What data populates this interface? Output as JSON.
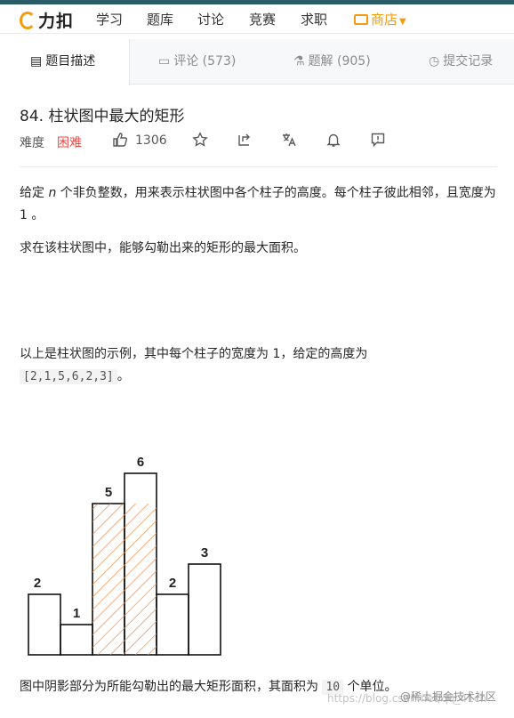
{
  "nav": {
    "logo": "力扣",
    "items": [
      "学习",
      "题库",
      "讨论",
      "竞赛",
      "求职"
    ],
    "shop": "商店"
  },
  "tabs": [
    {
      "label": "题目描述"
    },
    {
      "label": "评论 (573)"
    },
    {
      "label": "题解 (905)"
    },
    {
      "label": "提交记录"
    }
  ],
  "problem": {
    "title": "84. 柱状图中最大的矩形",
    "difficulty_label": "难度",
    "difficulty": "困难",
    "likes": "1306"
  },
  "description": {
    "p1_pre": "给定 ",
    "p1_var": "n",
    "p1_post": " 个非负整数，用来表示柱状图中各个柱子的高度。每个柱子彼此相邻，且宽度为 1 。",
    "p2": "求在该柱状图中，能够勾勒出来的矩形的最大面积。",
    "p3_pre": "以上是柱状图的示例，其中每个柱子的宽度为 1，给定的高度为 ",
    "p3_code": "[2,1,5,6,2,3]",
    "p3_post": "。",
    "p4_pre": "图中阴影部分为所能勾勒出的最大矩形面积，其面积为 ",
    "p4_code": "10",
    "p4_post": " 个单位。"
  },
  "chart_data": {
    "type": "bar",
    "categories": [
      "",
      "",
      "",
      "",
      "",
      ""
    ],
    "values": [
      2,
      1,
      5,
      6,
      2,
      3
    ],
    "data_labels": [
      "2",
      "1",
      "5",
      "6",
      "2",
      "3"
    ],
    "highlight": {
      "start_index": 2,
      "end_index": 3,
      "height": 5,
      "color": "#f08c4a"
    },
    "ylim": [
      0,
      6
    ]
  },
  "watermark": {
    "url": "https://blog.csdn.net/qq_41ch",
    "community": "@稀土掘金技术社区"
  }
}
